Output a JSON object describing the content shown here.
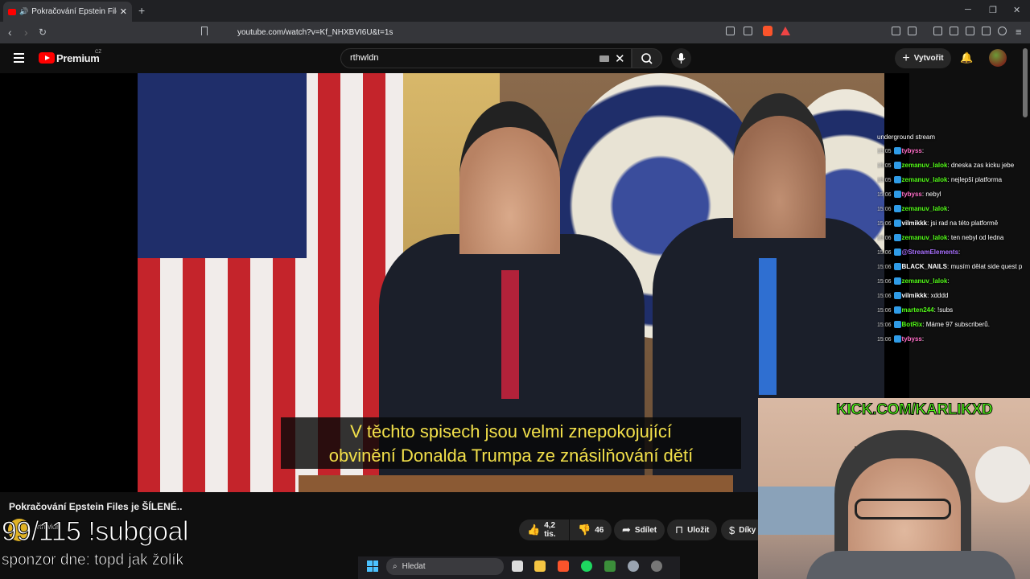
{
  "browser": {
    "tab_title": "Pokračování Epstein Files je ŠÍLENÉ",
    "tab_close": "✕",
    "new_tab": "+",
    "url": "youtube.com/watch?v=Kf_NHXBVI6U&t=1s"
  },
  "youtube": {
    "brand": "Premium",
    "region": "CZ",
    "search_value": "rthwldn",
    "create_label": "Vytvořit"
  },
  "video": {
    "subtitle_line1": "V těchto spisech jsou velmi znepokojující",
    "subtitle_line2": "obvinění Donalda Trumpa ze znásilňování dětí",
    "title": "Pokračování Epstein Files je ŠÍLENÉ..",
    "channel_name": "rthwldn",
    "likes": "4,2 tis.",
    "dislikes": "46",
    "share_label": "Sdílet",
    "save_label": "Uložit",
    "thanks_label": "Díky"
  },
  "overlay": {
    "subgoal": "99/115 !subgoal",
    "sponsor": "sponzor dne: topd jak žolík",
    "kick": "KICK.COM/KARLIKXD"
  },
  "chat": {
    "header": "underground stream",
    "messages": [
      {
        "time": "15:05",
        "user": "tybyss",
        "text": "",
        "color": "#ff6ec7"
      },
      {
        "time": "15:05",
        "user": "zemanuv_lalok",
        "text": "dneska zas kicku jebe",
        "color": "#53fc18"
      },
      {
        "time": "15:05",
        "user": "zemanuv_lalok",
        "text": "nejlepší platforma",
        "color": "#53fc18"
      },
      {
        "time": "15:06",
        "user": "tybyss",
        "text": "nebyl",
        "color": "#ff6ec7"
      },
      {
        "time": "15:06",
        "user": "zemanuv_lalok",
        "text": "",
        "color": "#53fc18"
      },
      {
        "time": "15:06",
        "user": "vilmikkk",
        "text": "jsi rad na této platformě",
        "color": "#ffffff"
      },
      {
        "time": "15:06",
        "user": "zemanuv_lalok",
        "text": "ten nebyl od ledna",
        "color": "#53fc18"
      },
      {
        "time": "15:06",
        "user": "@StreamElements",
        "text": "",
        "color": "#a970ff"
      },
      {
        "time": "15:06",
        "user": "BLACK_NAILS",
        "text": "musím dělat side quest puzzle aby to šlo",
        "color": "#ffffff"
      },
      {
        "time": "15:06",
        "user": "zemanuv_lalok",
        "text": "",
        "color": "#53fc18"
      },
      {
        "time": "15:06",
        "user": "vilmikkk",
        "text": "xdddd",
        "color": "#ffffff"
      },
      {
        "time": "15:06",
        "user": "marten244",
        "text": "!subs",
        "color": "#53fc18"
      },
      {
        "time": "15:06",
        "user": "BotRix",
        "text": "Máme 97 subscriberů.",
        "color": "#53fc18"
      },
      {
        "time": "15:06",
        "user": "tybyss",
        "text": "",
        "color": "#ff6ec7"
      }
    ]
  },
  "taskbar": {
    "search_label": "Hledat"
  }
}
